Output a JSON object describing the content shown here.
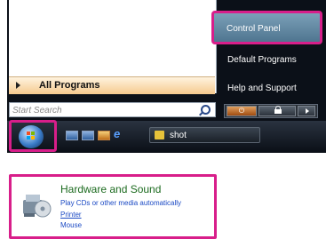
{
  "start_menu": {
    "all_programs_label": "All Programs",
    "search_placeholder": "Start Search",
    "right_items": [
      "Control Panel",
      "Default Programs",
      "Help and Support"
    ]
  },
  "taskbar": {
    "task_button_label": "shot"
  },
  "control_panel": {
    "category_title": "Hardware and Sound",
    "links": [
      "Play CDs or other media automatically",
      "Printer",
      "Mouse"
    ]
  },
  "colors": {
    "highlight_border": "#d81e8a",
    "category_title": "#1b6a1e",
    "link": "#1a49c4"
  }
}
